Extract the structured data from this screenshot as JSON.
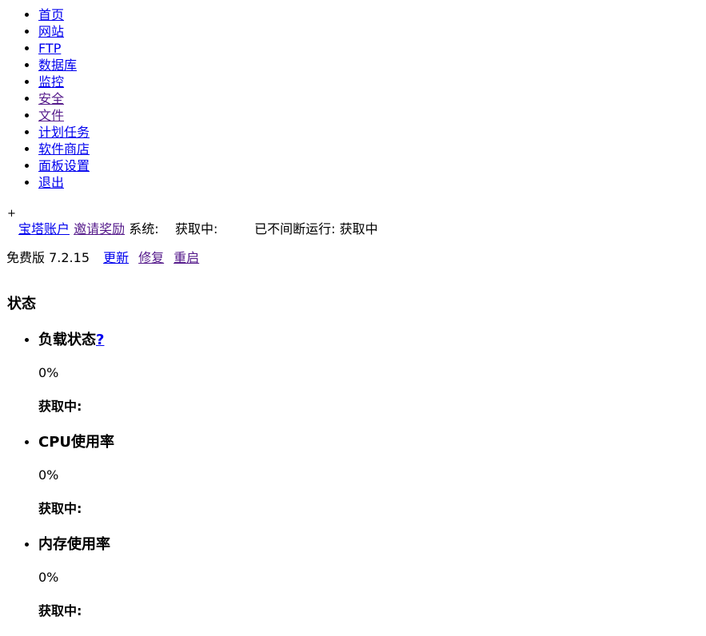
{
  "nav": {
    "items": [
      {
        "label": "首页",
        "visited": false
      },
      {
        "label": "网站",
        "visited": false
      },
      {
        "label": "FTP",
        "visited": false
      },
      {
        "label": "数据库",
        "visited": false
      },
      {
        "label": "监控",
        "visited": false
      },
      {
        "label": "安全",
        "visited": true
      },
      {
        "label": "文件",
        "visited": true
      },
      {
        "label": "计划任务",
        "visited": false
      },
      {
        "label": "软件商店",
        "visited": false
      },
      {
        "label": "面板设置",
        "visited": false
      },
      {
        "label": "退出",
        "visited": false
      }
    ]
  },
  "header": {
    "plus": "+",
    "account_link": "宝塔账户",
    "invite_link": "邀请奖励",
    "system_label": "系统:",
    "system_value": "获取中:",
    "uptime_label": "已不间断运行:",
    "uptime_value": "获取中"
  },
  "version": {
    "edition": "免费版",
    "number": "7.2.15",
    "update": "更新",
    "repair": "修复",
    "restart": "重启"
  },
  "status": {
    "title": "状态",
    "items": [
      {
        "title": "负载状态",
        "help": "?",
        "value": "0%",
        "sub": "获取中:"
      },
      {
        "title": "CPU使用率",
        "help": "",
        "value": "0%",
        "sub": "获取中:"
      },
      {
        "title": "内存使用率",
        "help": "",
        "value": "0%",
        "sub": "获取中:"
      }
    ]
  },
  "colors": {
    "link": "#0000ee",
    "visited_link": "#551a8b",
    "text": "#000000",
    "background": "#ffffff"
  }
}
